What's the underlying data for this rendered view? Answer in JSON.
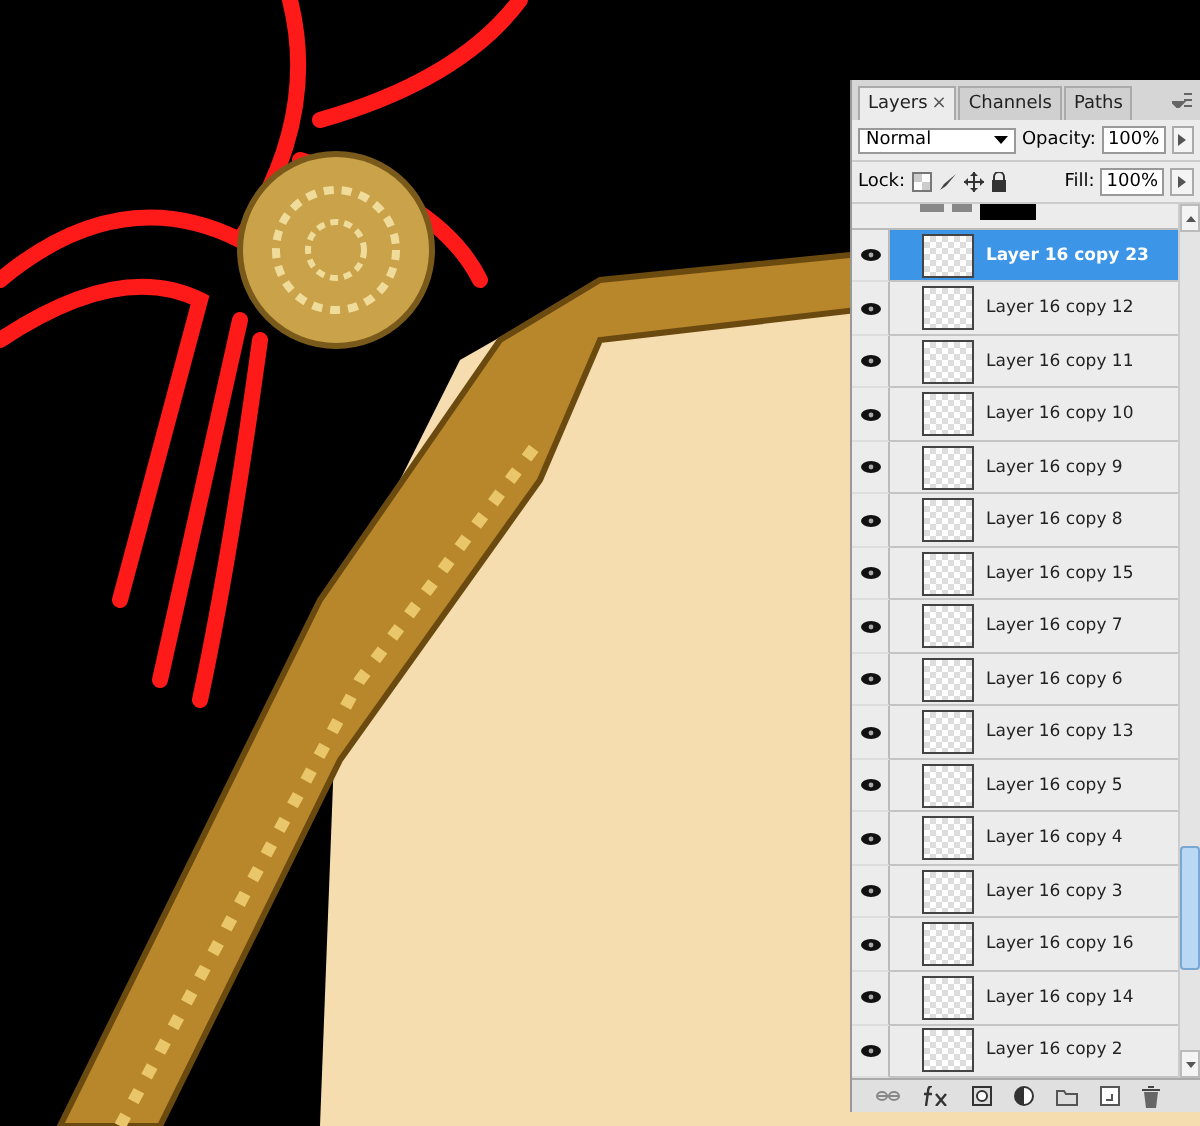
{
  "panel": {
    "tabs": [
      {
        "label": "Layers",
        "selected": true,
        "close": "×"
      },
      {
        "label": "Channels",
        "selected": false
      },
      {
        "label": "Paths",
        "selected": false
      }
    ],
    "blend_mode": "Normal",
    "opacity_label": "Opacity:",
    "opacity": "100%",
    "lock_label": "Lock:",
    "fill_label": "Fill:",
    "fill": "100%",
    "layers": [
      {
        "name": "Layer 16 copy 23",
        "visible": true,
        "selected": true
      },
      {
        "name": "Layer 16 copy 12",
        "visible": true,
        "selected": false
      },
      {
        "name": "Layer 16 copy 11",
        "visible": true,
        "selected": false
      },
      {
        "name": "Layer 16 copy 10",
        "visible": true,
        "selected": false
      },
      {
        "name": "Layer 16 copy 9",
        "visible": true,
        "selected": false
      },
      {
        "name": "Layer 16 copy 8",
        "visible": true,
        "selected": false
      },
      {
        "name": "Layer 16 copy 15",
        "visible": true,
        "selected": false
      },
      {
        "name": "Layer 16 copy 7",
        "visible": true,
        "selected": false
      },
      {
        "name": "Layer 16 copy 6",
        "visible": true,
        "selected": false
      },
      {
        "name": "Layer 16 copy 13",
        "visible": true,
        "selected": false
      },
      {
        "name": "Layer 16 copy 5",
        "visible": true,
        "selected": false
      },
      {
        "name": "Layer 16 copy 4",
        "visible": true,
        "selected": false
      },
      {
        "name": "Layer 16 copy 3",
        "visible": true,
        "selected": false
      },
      {
        "name": "Layer 16 copy 16",
        "visible": true,
        "selected": false
      },
      {
        "name": "Layer 16 copy 14",
        "visible": true,
        "selected": false
      },
      {
        "name": "Layer 16 copy 2",
        "visible": true,
        "selected": false
      }
    ]
  }
}
